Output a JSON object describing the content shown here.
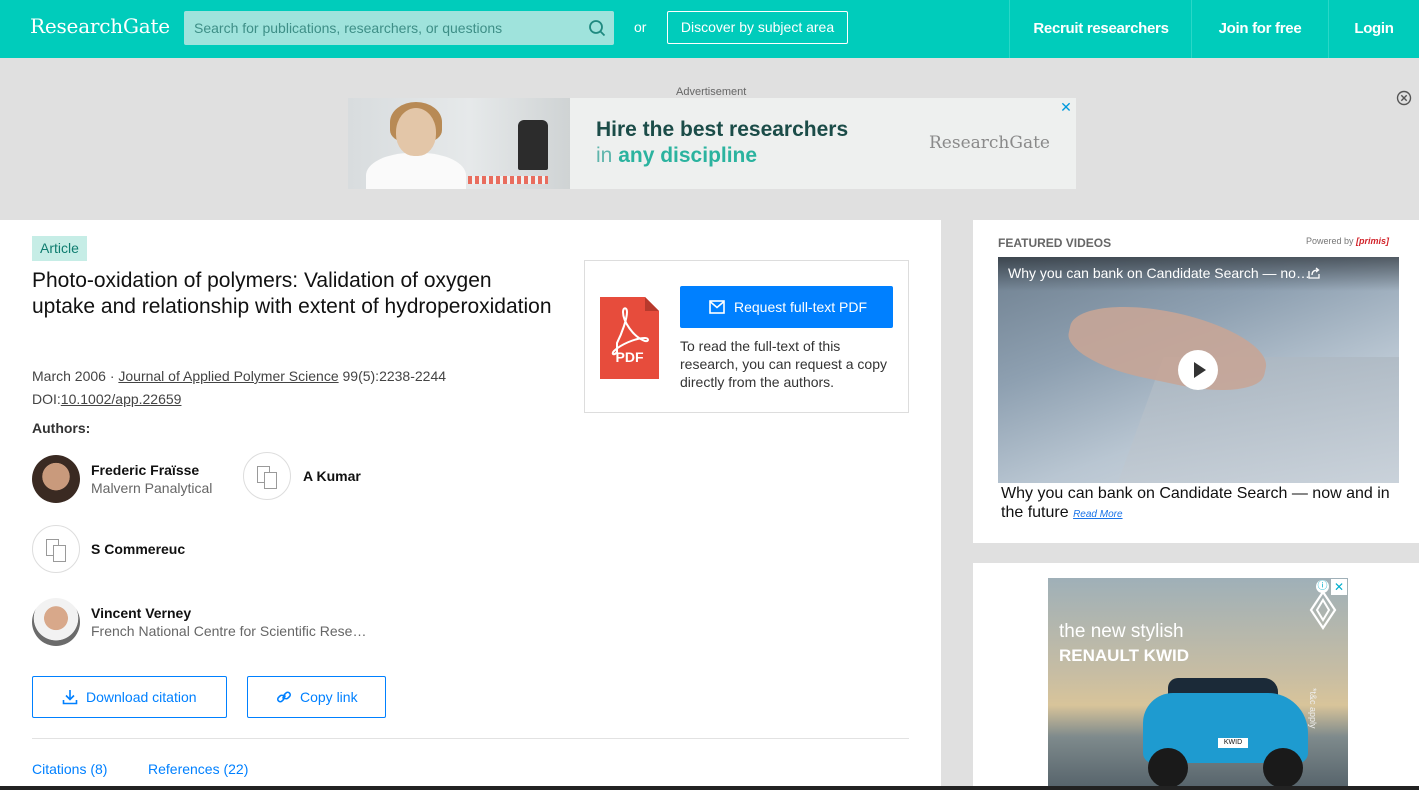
{
  "header": {
    "logo": "ResearchGate",
    "search_placeholder": "Search for publications, researchers, or questions",
    "or_text": "or",
    "discover_label": "Discover by subject area",
    "nav": [
      "Recruit researchers",
      "Join for free",
      "Login"
    ]
  },
  "ad_banner": {
    "label": "Advertisement",
    "headline": "Hire the best researchers",
    "subline_prefix": "in ",
    "subline_bold": "any discipline",
    "brand": "ResearchGate",
    "close": "✕"
  },
  "article": {
    "type_badge": "Article",
    "title": "Photo-oxidation of polymers: Validation of oxygen uptake and relationship with extent of hydroperoxidation",
    "date": "March 2006 · ",
    "journal": "Journal of Applied Polymer Science",
    "issue": " 99(5):2238-2244",
    "doi_label": "DOI:",
    "doi": "10.1002/app.22659",
    "authors_label": "Authors:",
    "authors": [
      {
        "name": "Frederic Fraïsse",
        "affiliation": "Malvern Panalytical"
      },
      {
        "name": "A Kumar",
        "affiliation": ""
      },
      {
        "name": "S Commereuc",
        "affiliation": ""
      },
      {
        "name": "Vincent Verney",
        "affiliation": "French National Centre for Scientific Rese…"
      }
    ],
    "download_citation": "Download citation",
    "copy_link": "Copy link",
    "tabs": [
      "Citations (8)",
      "References (22)"
    ]
  },
  "request_box": {
    "pdf_label": "PDF",
    "button": "Request full-text PDF",
    "text": "To read the full-text of this research, you can request a copy directly from the authors."
  },
  "featured_videos": {
    "label": "FEATURED VIDEOS",
    "powered_by": "Powered by ",
    "powered_brand": "[primis]",
    "video_title": "Why you can bank on Candidate Search — no…",
    "caption": "Why you can bank on Candidate Search — now and in the future",
    "read_more": "Read More"
  },
  "car_ad": {
    "line1": "the new stylish",
    "line2": "RENAULT KWID",
    "tc": "*t&c apply",
    "plate": "KWID",
    "info": "ⓘ",
    "close": "✕"
  },
  "colors": {
    "brand_teal": "#00ccbb",
    "primary_blue": "#0080ff",
    "pdf_red": "#e74c3c"
  }
}
